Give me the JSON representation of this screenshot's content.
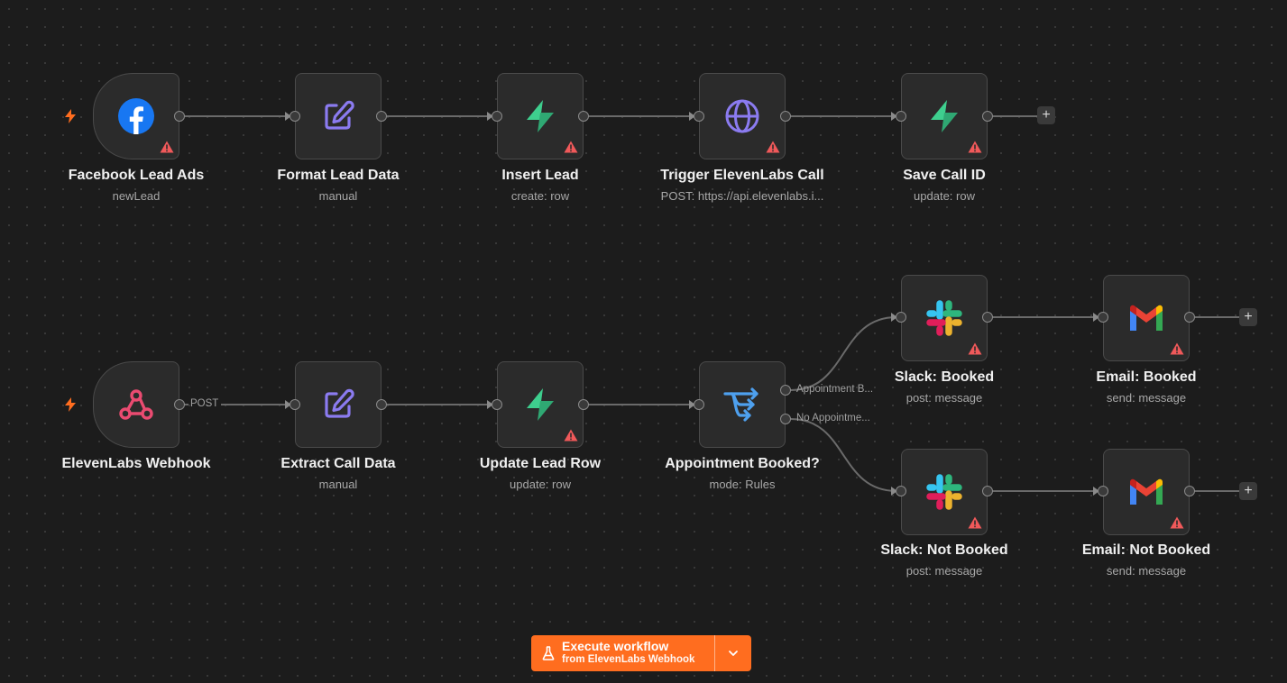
{
  "nodes": {
    "facebook_lead_ads": {
      "label": "Facebook Lead Ads",
      "subtitle": "newLead",
      "icon": "facebook-icon"
    },
    "format_lead_data": {
      "label": "Format Lead Data",
      "subtitle": "manual",
      "icon": "edit-icon"
    },
    "insert_lead": {
      "label": "Insert Lead",
      "subtitle": "create: row",
      "icon": "supabase-icon"
    },
    "trigger_call": {
      "label": "Trigger ElevenLabs Call",
      "subtitle": "POST: https://api.elevenlabs.i...",
      "icon": "globe-icon"
    },
    "save_call_id": {
      "label": "Save Call ID",
      "subtitle": "update: row",
      "icon": "supabase-icon"
    },
    "elevenlabs_webhook": {
      "label": "ElevenLabs Webhook",
      "subtitle": "",
      "icon": "webhook-icon"
    },
    "extract_call_data": {
      "label": "Extract Call Data",
      "subtitle": "manual",
      "icon": "edit-icon"
    },
    "update_lead_row": {
      "label": "Update Lead Row",
      "subtitle": "update: row",
      "icon": "supabase-icon"
    },
    "appointment_booked": {
      "label": "Appointment Booked?",
      "subtitle": "mode: Rules",
      "icon": "switch-icon"
    },
    "slack_booked": {
      "label": "Slack: Booked",
      "subtitle": "post: message",
      "icon": "slack-icon"
    },
    "email_booked": {
      "label": "Email: Booked",
      "subtitle": "send: message",
      "icon": "gmail-icon"
    },
    "slack_not_booked": {
      "label": "Slack: Not Booked",
      "subtitle": "post: message",
      "icon": "slack-icon"
    },
    "email_not_booked": {
      "label": "Email: Not Booked",
      "subtitle": "send: message",
      "icon": "gmail-icon"
    }
  },
  "edge_labels": {
    "webhook_post": "POST",
    "appointment_booked_output": "Appointment B...",
    "no_appointment_output": "No Appointme..."
  },
  "add_button_symbol": "+",
  "execute": {
    "label": "Execute workflow",
    "sublabel": "from ElevenLabs Webhook",
    "icon": "flask-icon",
    "dropdown_icon": "chevron-down-icon"
  },
  "colors": {
    "canvas": "#1c1c1c",
    "node_bg": "#2b2b2b",
    "accent": "#ff6d1f",
    "warning": "#f0595a",
    "edge": "#7a7a7a"
  }
}
